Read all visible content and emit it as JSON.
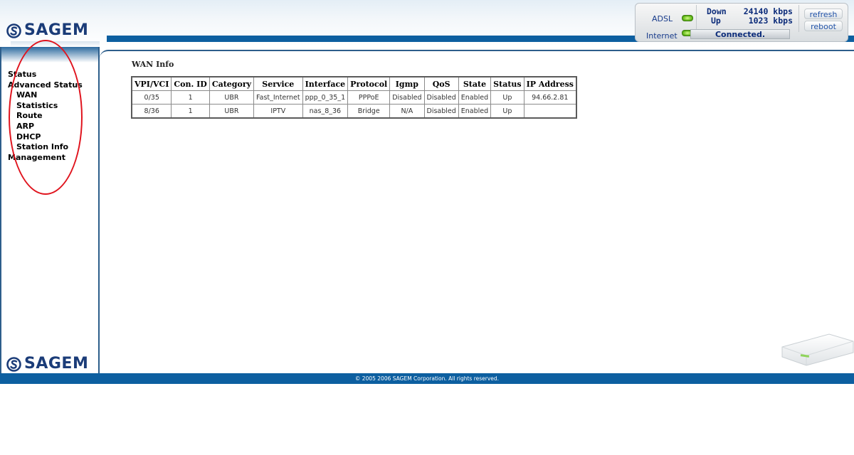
{
  "brand": {
    "name": "SAGEM"
  },
  "status_widget": {
    "adsl_label": "ADSL",
    "internet_label": "Internet",
    "down_label": "Down",
    "down_rate": "24140 kbps",
    "up_label": "Up",
    "up_rate": "1023 kbps",
    "connection_status": "Connected.",
    "refresh_label": "refresh",
    "reboot_label": "reboot"
  },
  "sidebar": {
    "items": [
      {
        "label": "Status",
        "level": 0
      },
      {
        "label": "Advanced Status",
        "level": 0
      },
      {
        "label": "WAN",
        "level": 1
      },
      {
        "label": "Statistics",
        "level": 1
      },
      {
        "label": "Route",
        "level": 1
      },
      {
        "label": "ARP",
        "level": 1
      },
      {
        "label": "DHCP",
        "level": 1
      },
      {
        "label": "Station Info",
        "level": 1
      },
      {
        "label": "Management",
        "level": 0
      }
    ]
  },
  "main": {
    "title": "WAN Info",
    "table": {
      "headers": [
        "VPI/VCI",
        "Con. ID",
        "Category",
        "Service",
        "Interface",
        "Protocol",
        "Igmp",
        "QoS",
        "State",
        "Status",
        "IP Address"
      ],
      "rows": [
        [
          "0/35",
          "1",
          "UBR",
          "Fast_Internet",
          "ppp_0_35_1",
          "PPPoE",
          "Disabled",
          "Disabled",
          "Enabled",
          "Up",
          "94.66.2.81"
        ],
        [
          "8/36",
          "1",
          "UBR",
          "IPTV",
          "nas_8_36",
          "Bridge",
          "N/A",
          "Disabled",
          "Enabled",
          "Up",
          ""
        ]
      ]
    }
  },
  "footer": {
    "copyright": "© 2005 2006 SAGEM Corporation. All rights reserved."
  },
  "colors": {
    "brand_blue": "#0d5fa0",
    "annotation_red": "#e0141e",
    "led_green": "#58b010"
  }
}
